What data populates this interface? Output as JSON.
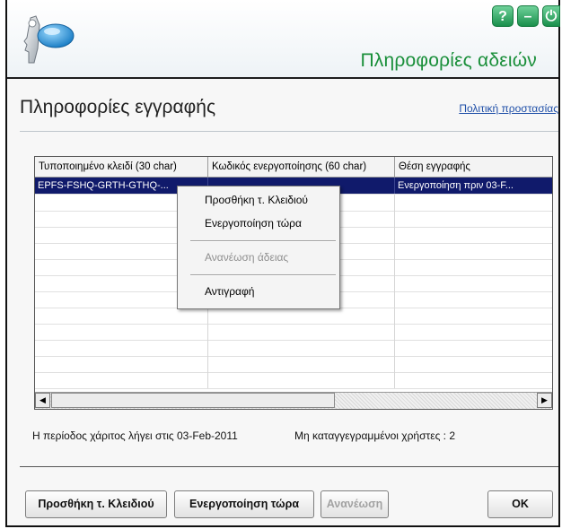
{
  "header": {
    "title": "Πληροφορίες αδειών",
    "help_label": "?",
    "minimize_label": "–",
    "power_label": "⏻"
  },
  "page": {
    "title": "Πληροφορίες εγγραφής",
    "privacy_link": "Πολιτική προστασίας"
  },
  "table": {
    "columns": [
      "Τυποποιημένο κλειδί (30 char)",
      "Κωδικός ενεργοποίησης (60 char)",
      "Θέση εγγραφής"
    ],
    "rows": [
      {
        "key": "EPFS-FSHQ-GRTH-GTHQ-...",
        "activation_code": "",
        "status": "Ενεργοποίηση πριν 03-F..."
      }
    ]
  },
  "context_menu": {
    "add_key": "Προσθήκη τ. Κλειδιού",
    "activate_now": "Ενεργοποίηση τώρα",
    "renew_license": "Ανανέωση άδειας",
    "copy": "Αντιγραφή"
  },
  "status": {
    "grace_period": "Η περίοδος χάριτος λήγει στις 03-Feb-2011",
    "unregistered_users": "Μη καταγγεγραμμένοι χρήστες : 2"
  },
  "buttons": {
    "add_key": "Προσθήκη τ. Κλειδιού",
    "activate_now": "Ενεργοποίηση τώρα",
    "renew": "Ανανέωση",
    "ok": "OK"
  },
  "colors": {
    "accent_green": "#1a8f3a",
    "selection_navy": "#101a6b"
  },
  "icons": {
    "logo": "key-icon",
    "help": "help-icon",
    "minimize": "minimize-icon",
    "power": "power-icon"
  }
}
